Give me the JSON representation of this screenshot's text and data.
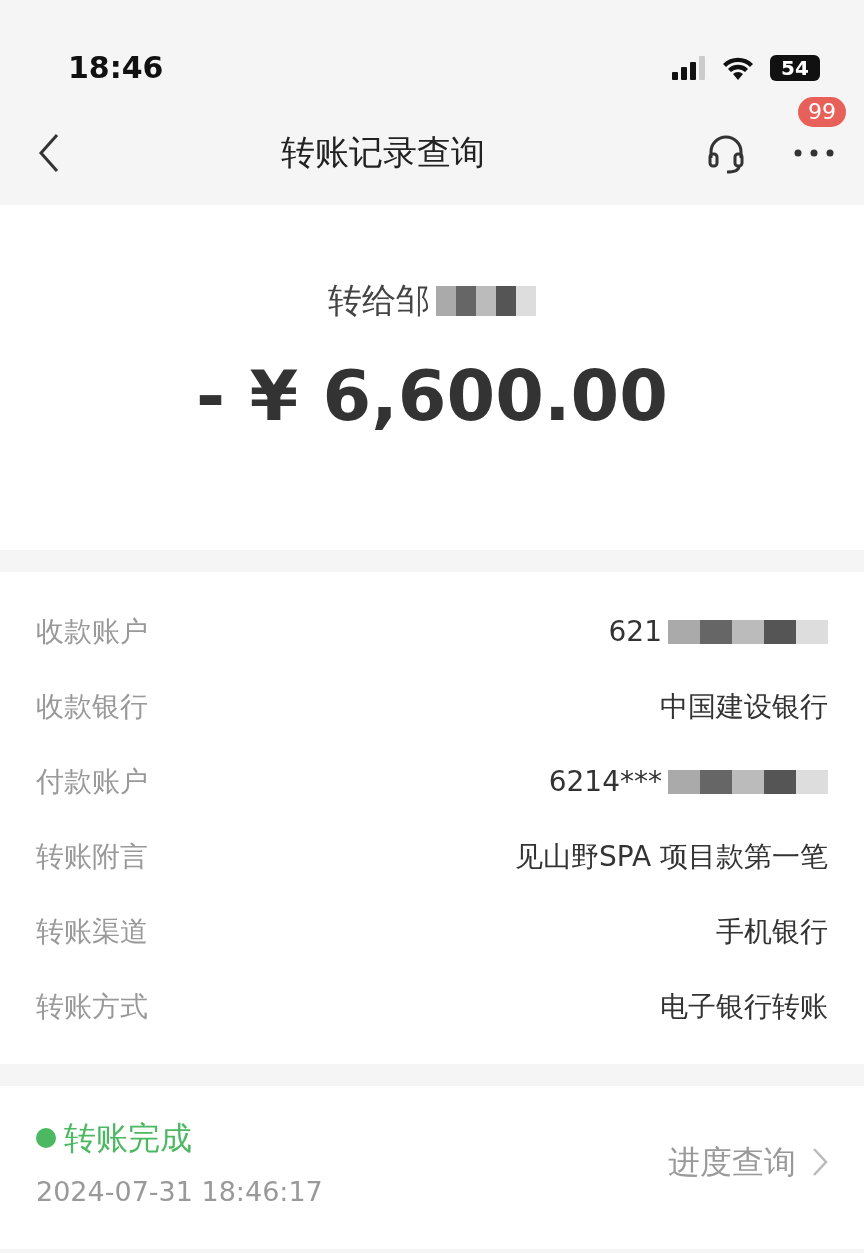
{
  "status_bar": {
    "time": "18:46",
    "battery": "54"
  },
  "header": {
    "title": "转账记录查询",
    "badge": "99"
  },
  "summary": {
    "payee": "转给邹",
    "payee_redacted": true,
    "amount": "- ¥ 6,600.00"
  },
  "details": [
    {
      "label": "收款账户",
      "value": "621",
      "redacted": true
    },
    {
      "label": "收款银行",
      "value": "中国建设银行",
      "redacted": false
    },
    {
      "label": "付款账户",
      "value": "6214***",
      "redacted": true
    },
    {
      "label": "转账附言",
      "value": "见山野SPA 项目款第一笔",
      "redacted": false
    },
    {
      "label": "转账渠道",
      "value": "手机银行",
      "redacted": false
    },
    {
      "label": "转账方式",
      "value": "电子银行转账",
      "redacted": false
    }
  ],
  "progress": {
    "status": "转账完成",
    "color": "#4cb862",
    "time": "2024-07-31 18:46:17",
    "link": "进度查询"
  }
}
